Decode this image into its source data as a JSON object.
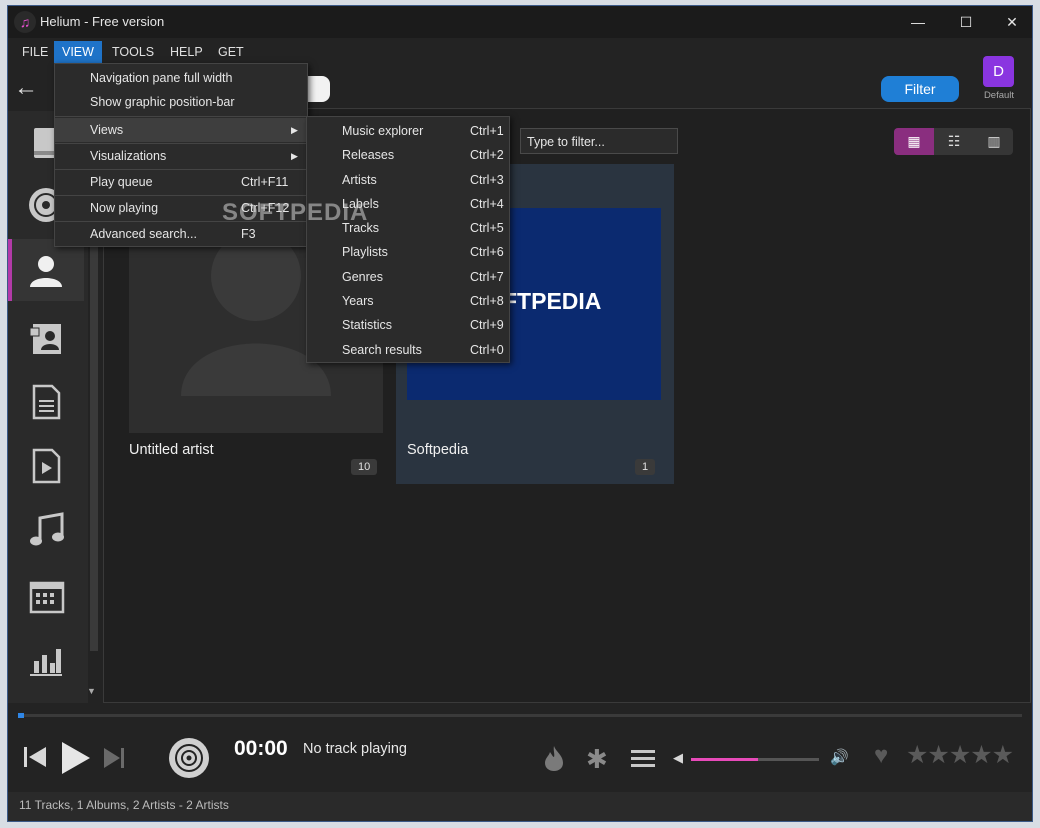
{
  "window": {
    "title": "Helium - Free version",
    "minimize_icon": "minimize-icon",
    "maximize_icon": "maximize-icon",
    "close_icon": "close-icon"
  },
  "menubar": {
    "file": "FILE",
    "view": "VIEW",
    "tools": "TOOLS",
    "help": "HELP",
    "premium": "GET PREMIUM VERSION"
  },
  "toolbar": {
    "filter_label": "Filter",
    "avatar_letter": "D",
    "avatar_caption": "Default",
    "back_icon": "back-arrow-icon",
    "type_filter_placeholder": "Type to filter..."
  },
  "view_menu": {
    "items": [
      {
        "label": "Navigation pane full width",
        "shortcut": ""
      },
      {
        "label": "Show graphic position-bar",
        "shortcut": ""
      },
      {
        "label": "Views",
        "shortcut": "",
        "submenu": true
      },
      {
        "label": "Visualizations",
        "shortcut": "",
        "submenu": true
      },
      {
        "label": "Play queue",
        "shortcut": "Ctrl+F11"
      },
      {
        "label": "Now playing",
        "shortcut": "Ctrl+F12"
      },
      {
        "label": "Advanced search...",
        "shortcut": "F3"
      }
    ]
  },
  "views_submenu": {
    "items": [
      {
        "label": "Music explorer",
        "shortcut": "Ctrl+1"
      },
      {
        "label": "Releases",
        "shortcut": "Ctrl+2"
      },
      {
        "label": "Artists",
        "shortcut": "Ctrl+3"
      },
      {
        "label": "Labels",
        "shortcut": "Ctrl+4"
      },
      {
        "label": "Tracks",
        "shortcut": "Ctrl+5"
      },
      {
        "label": "Playlists",
        "shortcut": "Ctrl+6"
      },
      {
        "label": "Genres",
        "shortcut": "Ctrl+7"
      },
      {
        "label": "Years",
        "shortcut": "Ctrl+8"
      },
      {
        "label": "Statistics",
        "shortcut": "Ctrl+9"
      },
      {
        "label": "Search results",
        "shortcut": "Ctrl+0"
      }
    ]
  },
  "sidebar": {
    "items": [
      {
        "icon": "library-book-icon"
      },
      {
        "icon": "disc-icon"
      },
      {
        "icon": "artist-person-icon",
        "selected": true
      },
      {
        "icon": "locked-contacts-icon"
      },
      {
        "icon": "document-list-icon"
      },
      {
        "icon": "video-file-icon"
      },
      {
        "icon": "locked-music-note-icon"
      },
      {
        "icon": "locked-calendar-icon"
      },
      {
        "icon": "locked-statistics-icon"
      }
    ]
  },
  "artists": [
    {
      "name": "Untitled artist",
      "count": "10"
    },
    {
      "name": "Softpedia",
      "count": "1",
      "logo_text": "FTPEDIA"
    }
  ],
  "watermark": "SOFTPEDIA",
  "player": {
    "time": "00:00",
    "status": "No track playing",
    "volume_fraction": 0.52,
    "rating_stars": 0
  },
  "statusbar": {
    "text": "11 Tracks, 1 Albums, 2 Artists - 2 Artists"
  },
  "colors": {
    "accent": "#1f7fd6",
    "selection": "#b23aa8",
    "volume": "#e74ab9",
    "avatar": "#8a35e0"
  }
}
